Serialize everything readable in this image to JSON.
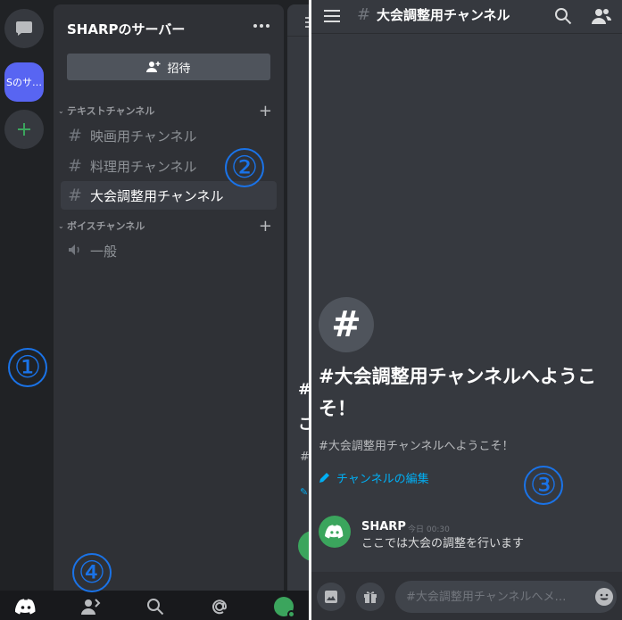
{
  "server": {
    "name": "SHARPのサーバー",
    "short": "Sのサ…",
    "invite_label": "招待"
  },
  "categories": {
    "text": "テキストチャンネル",
    "voice": "ボイスチャンネル"
  },
  "channels": [
    {
      "label": "映画用チャンネル"
    },
    {
      "label": "料理用チャンネル"
    },
    {
      "label": "大会調整用チャンネル",
      "active": true
    }
  ],
  "voice_channels": [
    {
      "label": "一般"
    }
  ],
  "hash_symbol": "#",
  "peek": {
    "line1": "#",
    "line2": "こ",
    "hash_small": "#"
  },
  "annotations": [
    "①",
    "②",
    "③",
    "④"
  ],
  "header": {
    "channel_title": "大会調整用チャンネル"
  },
  "welcome": {
    "title": "#大会調整用チャンネルへようこそ！",
    "subtitle": "#大会調整用チャンネルへようこそ！",
    "edit_link": "チャンネルの編集"
  },
  "message": {
    "author": "SHARP",
    "time": "今日 00:30",
    "text": "ここでは大会の調整を行います"
  },
  "composer": {
    "placeholder": "#大会調整用チャンネルへメ…"
  },
  "colors": {
    "blurple": "#5865f2",
    "green": "#3ba55d",
    "link": "#00aff4",
    "annotation": "#1a73e8"
  }
}
